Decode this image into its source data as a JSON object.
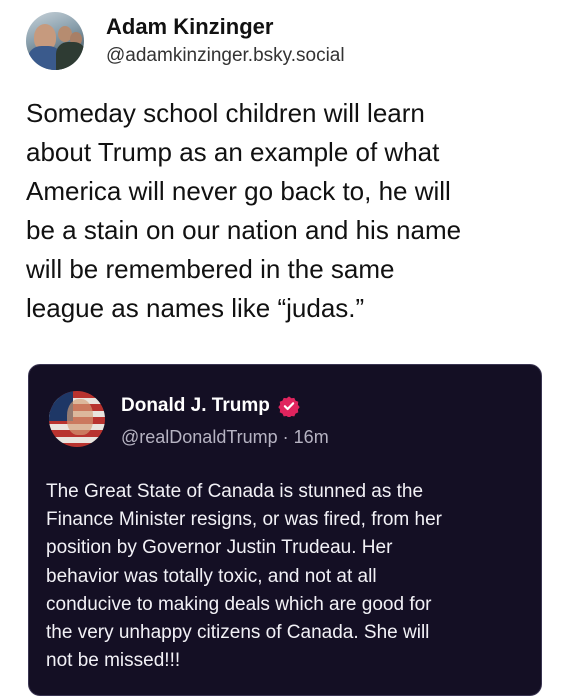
{
  "post": {
    "author_name": "Adam Kinzinger",
    "author_handle": "@adamkinzinger.bsky.social",
    "text_lines": [
      "Someday school children will learn",
      "about Trump as an example of what",
      "America will never go back to, he will",
      "be a stain on our nation and his name",
      "will be remembered in the same",
      "league as names like “judas.”"
    ]
  },
  "quoted_post": {
    "author_name": "Donald J. Trump",
    "author_handle": "@realDonaldTrump",
    "timestamp": "16m",
    "separator": " · ",
    "verified_icon": "verified-badge-icon",
    "text_lines": [
      "The Great State of Canada is stunned as the",
      "Finance Minister resigns, or was fired, from her",
      "position by Governor Justin Trudeau. Her",
      "behavior was totally toxic, and not at all",
      "conducive to making deals which are good for",
      "the very unhappy citizens of Canada. She will",
      "not be missed!!!"
    ]
  },
  "colors": {
    "card_background": "#140f24",
    "verified_badge": "#e0245e"
  }
}
